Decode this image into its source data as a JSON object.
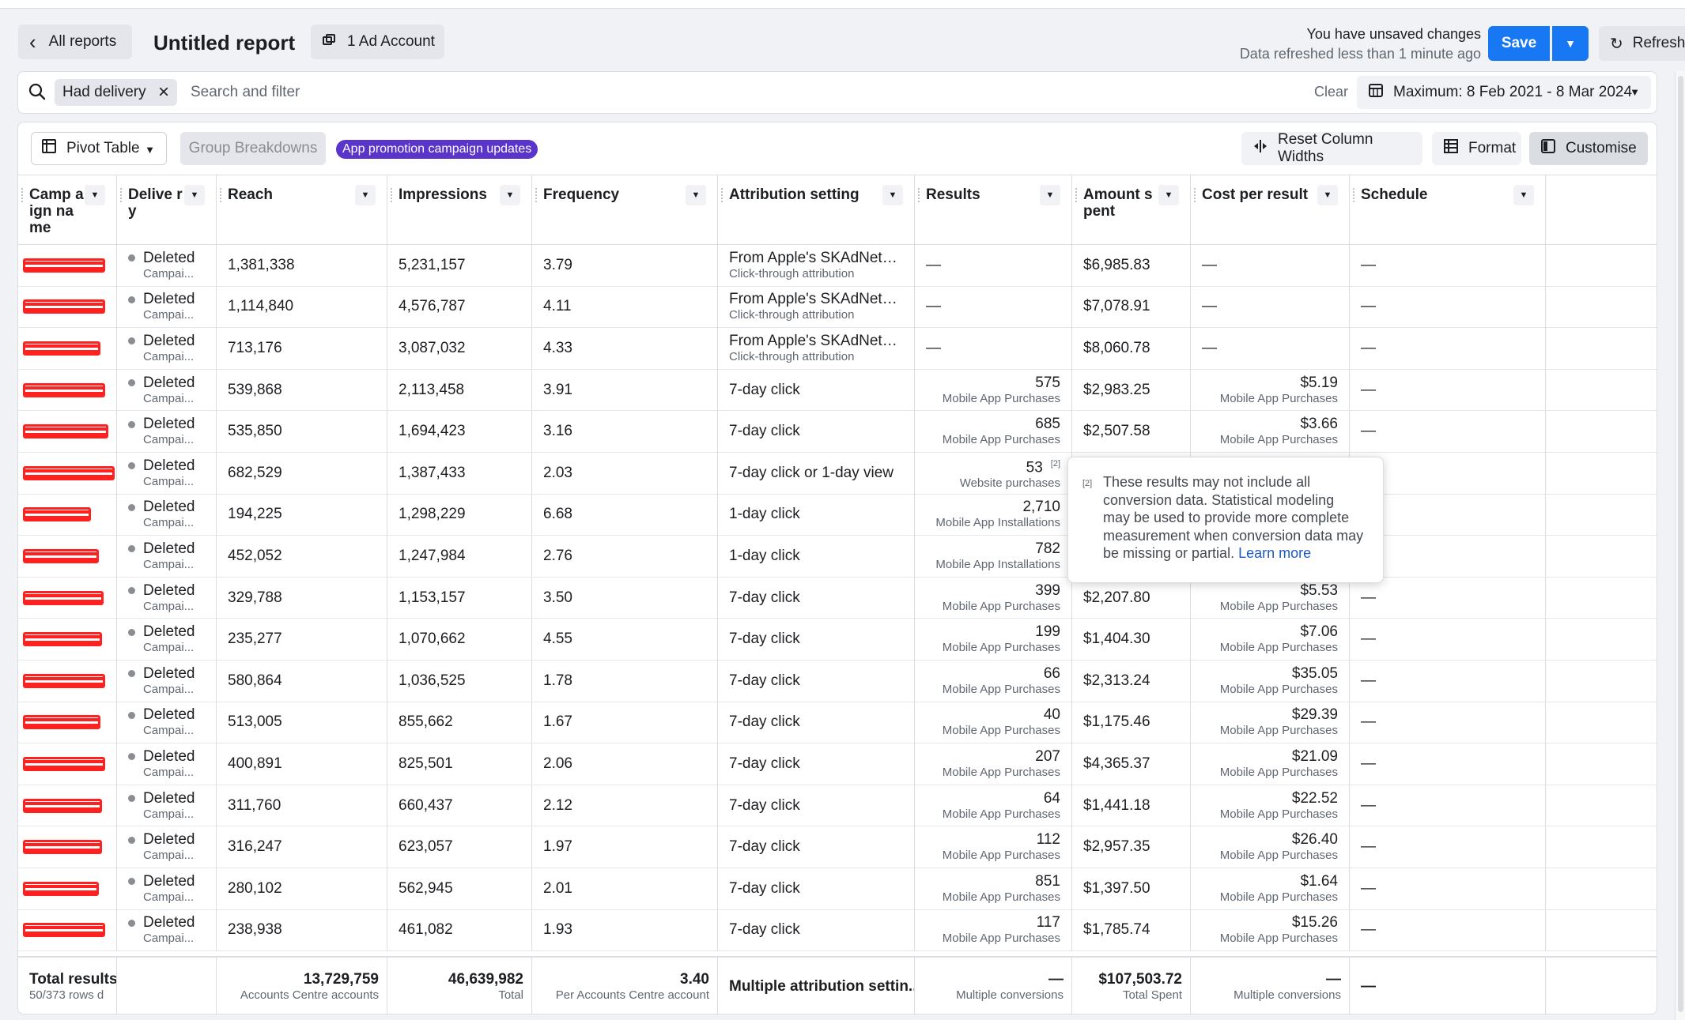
{
  "header": {
    "back_label": "All reports",
    "title": "Untitled report",
    "account_label": "1 Ad Account",
    "unsaved_text": "You have unsaved changes",
    "refreshed_text": "Data refreshed less than 1 minute ago",
    "save_label": "Save",
    "refresh_label": "Refresh"
  },
  "search": {
    "chip_label": "Had delivery",
    "placeholder": "Search and filter",
    "clear_label": "Clear",
    "date_range": "Maximum: 8 Feb 2021 - 8 Mar 2024"
  },
  "toolbar": {
    "pivot_label": "Pivot Table",
    "group_label": "Group Breakdowns",
    "promo_badge": "App promotion campaign updates",
    "reset_label": "Reset Column Widths",
    "format_label": "Format",
    "customise_label": "Customise"
  },
  "columns": [
    {
      "label": "Camp aign name"
    },
    {
      "label": "Delive ry"
    },
    {
      "label": "Reach"
    },
    {
      "label": "Impressions"
    },
    {
      "label": "Frequency"
    },
    {
      "label": "Attribution setting"
    },
    {
      "label": "Results"
    },
    {
      "label": "Amount spent"
    },
    {
      "label": "Cost per result"
    },
    {
      "label": "Schedule"
    }
  ],
  "rows": [
    {
      "status": "Deleted",
      "status_sub": "Campai...",
      "reach": "1,381,338",
      "impressions": "5,231,157",
      "frequency": "3.79",
      "attr": "From Apple's SKAdNetwor...",
      "attr_sub": "Click-through attribution",
      "results": "—",
      "results_sub": "",
      "spent": "$6,985.83",
      "cpr": "—",
      "cpr_sub": "",
      "schedule": "—"
    },
    {
      "status": "Deleted",
      "status_sub": "Campai...",
      "reach": "1,114,840",
      "impressions": "4,576,787",
      "frequency": "4.11",
      "attr": "From Apple's SKAdNetwor...",
      "attr_sub": "Click-through attribution",
      "results": "—",
      "results_sub": "",
      "spent": "$7,078.91",
      "cpr": "—",
      "cpr_sub": "",
      "schedule": "—"
    },
    {
      "status": "Deleted",
      "status_sub": "Campai...",
      "reach": "713,176",
      "impressions": "3,087,032",
      "frequency": "4.33",
      "attr": "From Apple's SKAdNetwor...",
      "attr_sub": "Click-through attribution",
      "results": "—",
      "results_sub": "",
      "spent": "$8,060.78",
      "cpr": "—",
      "cpr_sub": "",
      "schedule": "—"
    },
    {
      "status": "Deleted",
      "status_sub": "Campai...",
      "reach": "539,868",
      "impressions": "2,113,458",
      "frequency": "3.91",
      "attr": "7-day click",
      "attr_sub": "",
      "results": "575",
      "results_sub": "Mobile App Purchases",
      "spent": "$2,983.25",
      "cpr": "$5.19",
      "cpr_sub": "Mobile App Purchases",
      "schedule": "—"
    },
    {
      "status": "Deleted",
      "status_sub": "Campai...",
      "reach": "535,850",
      "impressions": "1,694,423",
      "frequency": "3.16",
      "attr": "7-day click",
      "attr_sub": "",
      "results": "685",
      "results_sub": "Mobile App Purchases",
      "spent": "$2,507.58",
      "cpr": "$3.66",
      "cpr_sub": "Mobile App Purchases",
      "schedule": "—"
    },
    {
      "status": "Deleted",
      "status_sub": "Campai...",
      "reach": "682,529",
      "impressions": "1,387,433",
      "frequency": "2.03",
      "attr": "7-day click or 1-day view",
      "attr_sub": "",
      "results": "53",
      "results_mark": "[2]",
      "results_sub": "Website purchases",
      "spent": "",
      "cpr": "",
      "cpr_sub": "",
      "schedule": ""
    },
    {
      "status": "Deleted",
      "status_sub": "Campai...",
      "reach": "194,225",
      "impressions": "1,298,229",
      "frequency": "6.68",
      "attr": "1-day click",
      "attr_sub": "",
      "results": "2,710",
      "results_sub": "Mobile App Installations",
      "spent": "",
      "cpr": "",
      "cpr_sub": "",
      "schedule": ""
    },
    {
      "status": "Deleted",
      "status_sub": "Campai...",
      "reach": "452,052",
      "impressions": "1,247,984",
      "frequency": "2.76",
      "attr": "1-day click",
      "attr_sub": "",
      "results": "782",
      "results_sub": "Mobile App Installations",
      "spent": "",
      "cpr": "",
      "cpr_sub": "",
      "schedule": ""
    },
    {
      "status": "Deleted",
      "status_sub": "Campai...",
      "reach": "329,788",
      "impressions": "1,153,157",
      "frequency": "3.50",
      "attr": "7-day click",
      "attr_sub": "",
      "results": "399",
      "results_sub": "Mobile App Purchases",
      "spent": "$2,207.80",
      "cpr": "$5.53",
      "cpr_sub": "Mobile App Purchases",
      "schedule": "—"
    },
    {
      "status": "Deleted",
      "status_sub": "Campai...",
      "reach": "235,277",
      "impressions": "1,070,662",
      "frequency": "4.55",
      "attr": "7-day click",
      "attr_sub": "",
      "results": "199",
      "results_sub": "Mobile App Purchases",
      "spent": "$1,404.30",
      "cpr": "$7.06",
      "cpr_sub": "Mobile App Purchases",
      "schedule": "—"
    },
    {
      "status": "Deleted",
      "status_sub": "Campai...",
      "reach": "580,864",
      "impressions": "1,036,525",
      "frequency": "1.78",
      "attr": "7-day click",
      "attr_sub": "",
      "results": "66",
      "results_sub": "Mobile App Purchases",
      "spent": "$2,313.24",
      "cpr": "$35.05",
      "cpr_sub": "Mobile App Purchases",
      "schedule": "—"
    },
    {
      "status": "Deleted",
      "status_sub": "Campai...",
      "reach": "513,005",
      "impressions": "855,662",
      "frequency": "1.67",
      "attr": "7-day click",
      "attr_sub": "",
      "results": "40",
      "results_sub": "Mobile App Purchases",
      "spent": "$1,175.46",
      "cpr": "$29.39",
      "cpr_sub": "Mobile App Purchases",
      "schedule": "—"
    },
    {
      "status": "Deleted",
      "status_sub": "Campai...",
      "reach": "400,891",
      "impressions": "825,501",
      "frequency": "2.06",
      "attr": "7-day click",
      "attr_sub": "",
      "results": "207",
      "results_sub": "Mobile App Purchases",
      "spent": "$4,365.37",
      "cpr": "$21.09",
      "cpr_sub": "Mobile App Purchases",
      "schedule": "—"
    },
    {
      "status": "Deleted",
      "status_sub": "Campai...",
      "reach": "311,760",
      "impressions": "660,437",
      "frequency": "2.12",
      "attr": "7-day click",
      "attr_sub": "",
      "results": "64",
      "results_sub": "Mobile App Purchases",
      "spent": "$1,441.18",
      "cpr": "$22.52",
      "cpr_sub": "Mobile App Purchases",
      "schedule": "—"
    },
    {
      "status": "Deleted",
      "status_sub": "Campai...",
      "reach": "316,247",
      "impressions": "623,057",
      "frequency": "1.97",
      "attr": "7-day click",
      "attr_sub": "",
      "results": "112",
      "results_sub": "Mobile App Purchases",
      "spent": "$2,957.35",
      "cpr": "$26.40",
      "cpr_sub": "Mobile App Purchases",
      "schedule": "—"
    },
    {
      "status": "Deleted",
      "status_sub": "Campai...",
      "reach": "280,102",
      "impressions": "562,945",
      "frequency": "2.01",
      "attr": "7-day click",
      "attr_sub": "",
      "results": "851",
      "results_sub": "Mobile App Purchases",
      "spent": "$1,397.50",
      "cpr": "$1.64",
      "cpr_sub": "Mobile App Purchases",
      "schedule": "—"
    },
    {
      "status": "Deleted",
      "status_sub": "Campai...",
      "reach": "238,938",
      "impressions": "461,082",
      "frequency": "1.93",
      "attr": "7-day click",
      "attr_sub": "",
      "results": "117",
      "results_sub": "Mobile App Purchases",
      "spent": "$1,785.74",
      "cpr": "$15.26",
      "cpr_sub": "Mobile App Purchases",
      "schedule": "—"
    }
  ],
  "footer": {
    "total_label": "Total results",
    "total_sub": "50/373 rows d",
    "reach": "13,729,759",
    "reach_sub": "Accounts Centre accounts",
    "impressions": "46,639,982",
    "impressions_sub": "Total",
    "frequency": "3.40",
    "frequency_sub": "Per Accounts Centre account",
    "attr": "Multiple attribution settin...",
    "results": "—",
    "results_sub": "Multiple conversions",
    "spent": "$107,503.72",
    "spent_sub": "Total Spent",
    "cpr": "—",
    "cpr_sub": "Multiple conversions",
    "schedule": "—"
  },
  "tooltip": {
    "mark": "[2]",
    "text": "These results may not include all conversion data. Statistical modeling may be used to provide more complete measurement when conversion data may be missing or partial.",
    "learn_more": "Learn more"
  },
  "colors": {
    "primary": "#1877f2",
    "badge": "#5b34c9",
    "redaction": "#ff2020"
  }
}
